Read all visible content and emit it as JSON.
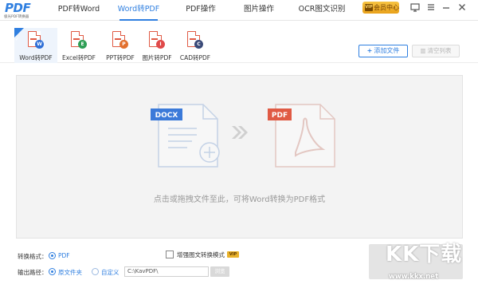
{
  "app": {
    "logo_text": "PDF",
    "logo_sub": "极光PDF转换器"
  },
  "nav": {
    "items": [
      {
        "label": "PDF转Word",
        "active": false
      },
      {
        "label": "Word转PDF",
        "active": true
      },
      {
        "label": "PDF操作",
        "active": false
      },
      {
        "label": "图片操作",
        "active": false
      },
      {
        "label": "OCR图文识别",
        "active": false
      }
    ],
    "vip_label": "会员中心",
    "vip_tag": "VIP"
  },
  "tools": [
    {
      "label": "Word转PDF",
      "badge": "W",
      "color": "#2f6fd6",
      "active": true
    },
    {
      "label": "Excel转PDF",
      "badge": "E",
      "color": "#2e9e55",
      "active": false
    },
    {
      "label": "PPT转PDF",
      "badge": "P",
      "color": "#e2702e",
      "active": false
    },
    {
      "label": "图片转PDF",
      "badge": "I",
      "color": "#e04a4a",
      "active": false
    },
    {
      "label": "CAD转PDF",
      "badge": "C",
      "color": "#3a4a78",
      "active": false
    }
  ],
  "toolbar": {
    "add_label": "添加文件",
    "clear_label": "清空列表"
  },
  "dropzone": {
    "from_tag": "DOCX",
    "to_tag": "PDF",
    "hint": "点击或拖拽文件至此，可将Word转换为PDF格式"
  },
  "options": {
    "format_label": "转换格式：",
    "format_value": "PDF",
    "enhance_label": "增强图文转换模式",
    "enhance_tag": "VIP",
    "output_label": "输出路径：",
    "output_opt1": "原文件夹",
    "output_opt2": "自定义",
    "path_value": "C:\\KavPDF\\",
    "browse_label": "浏览"
  },
  "watermark": {
    "text": "KK下载",
    "url": "www.kkx.net"
  },
  "colors": {
    "accent": "#2f7fe0",
    "pdf_red": "#e05a44"
  }
}
